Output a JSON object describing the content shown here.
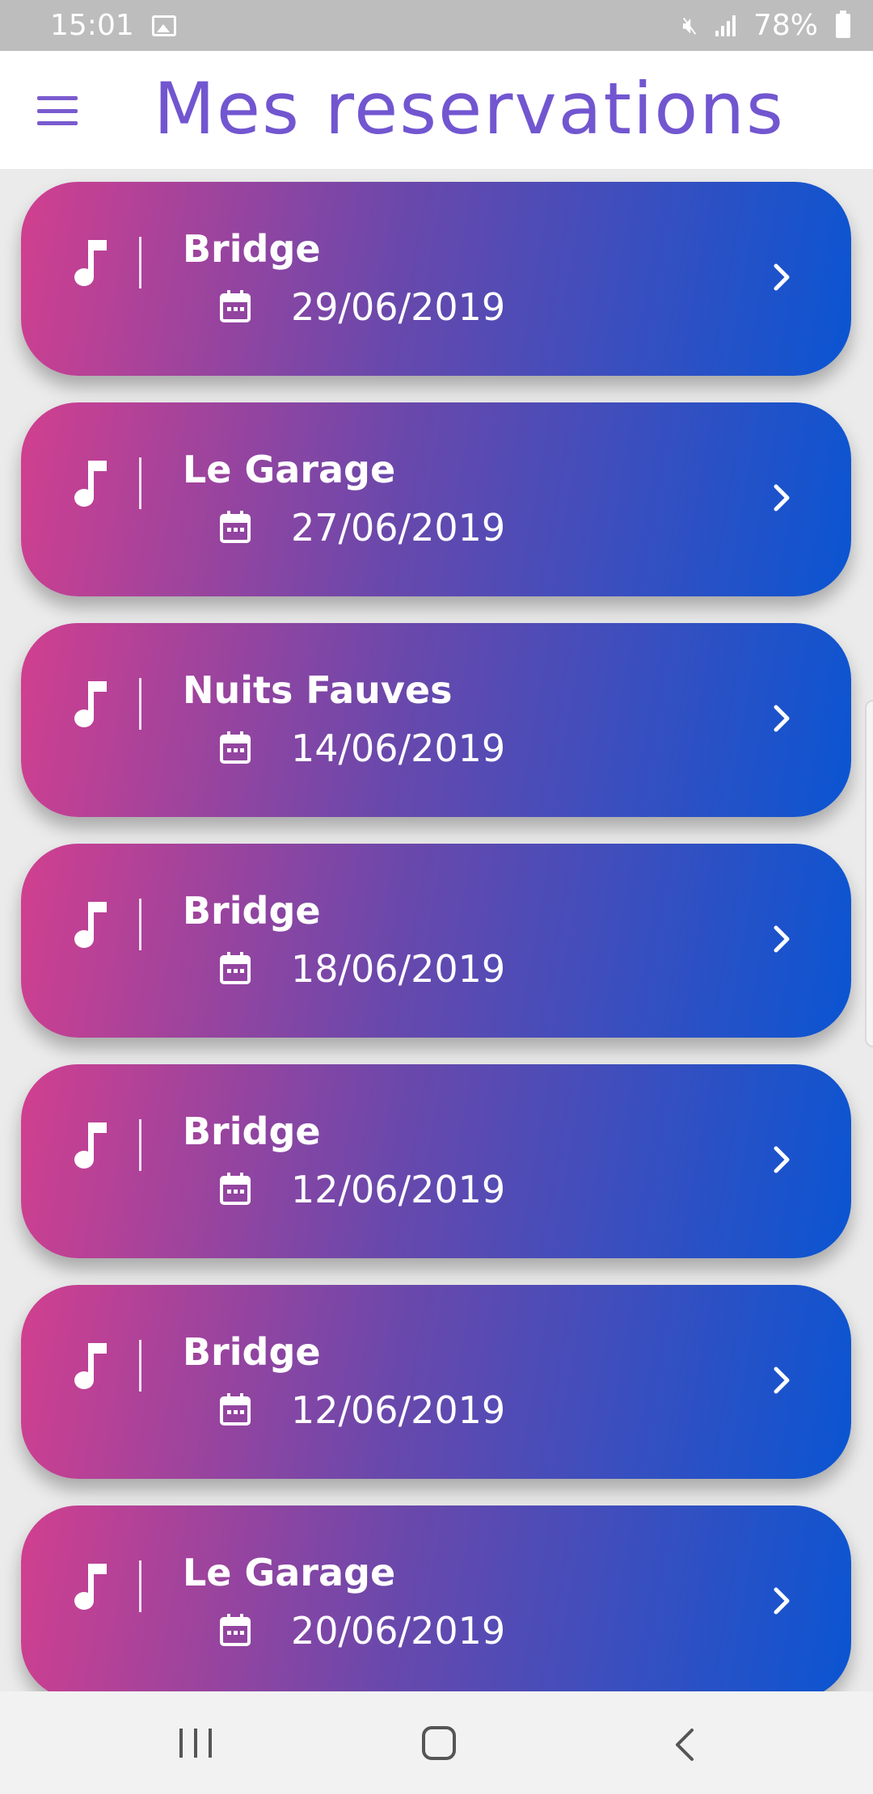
{
  "status_bar": {
    "time": "15:01",
    "battery": "78%",
    "icons": [
      "gallery-icon",
      "mute-icon",
      "signal-icon",
      "battery-icon"
    ]
  },
  "app_bar": {
    "title": "Mes reservations",
    "menu_icon": "menu-icon"
  },
  "reservations": [
    {
      "venue": "Bridge",
      "date": "29/06/2019"
    },
    {
      "venue": "Le Garage",
      "date": "27/06/2019"
    },
    {
      "venue": "Nuits Fauves",
      "date": "14/06/2019"
    },
    {
      "venue": "Bridge",
      "date": "18/06/2019"
    },
    {
      "venue": "Bridge",
      "date": "12/06/2019"
    },
    {
      "venue": "Bridge",
      "date": "12/06/2019"
    },
    {
      "venue": "Le Garage",
      "date": "20/06/2019"
    }
  ],
  "colors": {
    "accent": "#7256d0",
    "gradient_start": "#d23f8f",
    "gradient_mid": "#6a48ab",
    "gradient_end": "#0a55d2"
  },
  "nav_bar": {
    "icons": [
      "recent-apps-icon",
      "home-icon",
      "back-icon"
    ]
  }
}
